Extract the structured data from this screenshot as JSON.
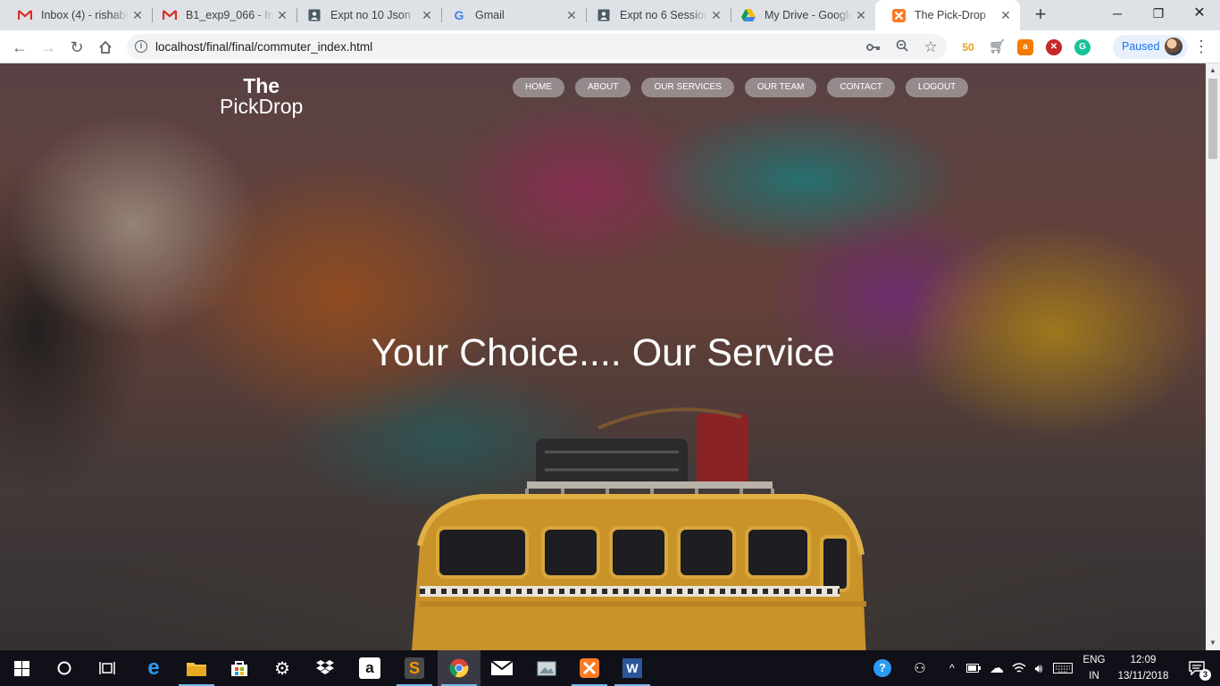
{
  "browser": {
    "tabs": [
      {
        "title": "Inbox (4) - rishabh",
        "icon": "gmail-icon"
      },
      {
        "title": "B1_exp9_066 - Inv",
        "icon": "gmail-icon"
      },
      {
        "title": "Expt no 10 Json",
        "icon": "classroom-icon"
      },
      {
        "title": "Gmail",
        "icon": "google-icon"
      },
      {
        "title": "Expt no 6 Session",
        "icon": "classroom-icon"
      },
      {
        "title": "My Drive - Google",
        "icon": "drive-icon"
      },
      {
        "title": "The Pick-Drop",
        "icon": "xampp-icon",
        "active": true
      }
    ],
    "url": "localhost/final/final/commuter_index.html",
    "profile_status": "Paused",
    "extensions": [
      "hindi-50-icon",
      "cart-icon",
      "lock-ext-icon",
      "block-ext-icon",
      "grammarly-icon"
    ]
  },
  "site": {
    "logo_line1": "The",
    "logo_line2": "PickDrop",
    "nav": [
      "HOME",
      "ABOUT",
      "OUR SERVICES",
      "OUR TEAM",
      "CONTACT",
      "LOGOUT"
    ],
    "headline": "Your Choice.... Our Service"
  },
  "taskbar": {
    "language_line1": "ENG",
    "language_line2": "IN",
    "time": "12:09",
    "date": "13/11/2018",
    "notification_count": "3"
  }
}
